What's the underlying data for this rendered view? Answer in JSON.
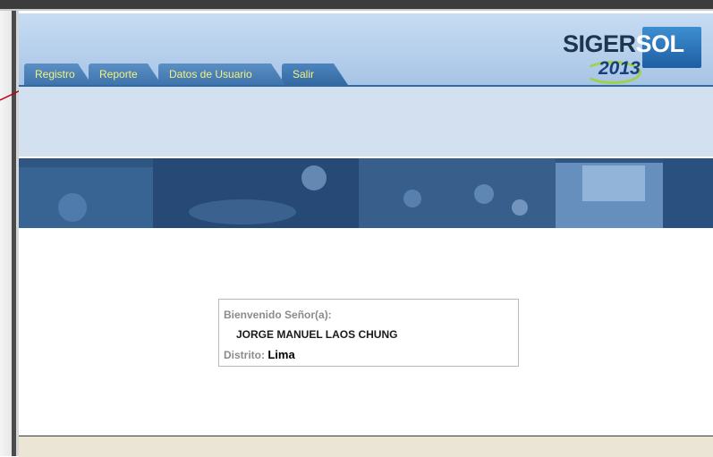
{
  "nav": {
    "tabs": [
      {
        "label": "Registro"
      },
      {
        "label": "Reporte"
      },
      {
        "label": "Datos de Usuario"
      },
      {
        "label": "Salir"
      }
    ]
  },
  "logo": {
    "brand_part1": "SIGER",
    "brand_part2": "SOL",
    "year": "2013"
  },
  "welcome": {
    "title": "Bienvenido Señor(a):",
    "user_name": "JORGE MANUEL LAOS CHUNG",
    "district_label": "Distrito:",
    "district_value": "Lima"
  },
  "colors": {
    "header_bg": "#b6cfec",
    "tab_bg": "#4a7fb8",
    "tab_text": "#f3f37a",
    "annotation": "#c0001a"
  }
}
